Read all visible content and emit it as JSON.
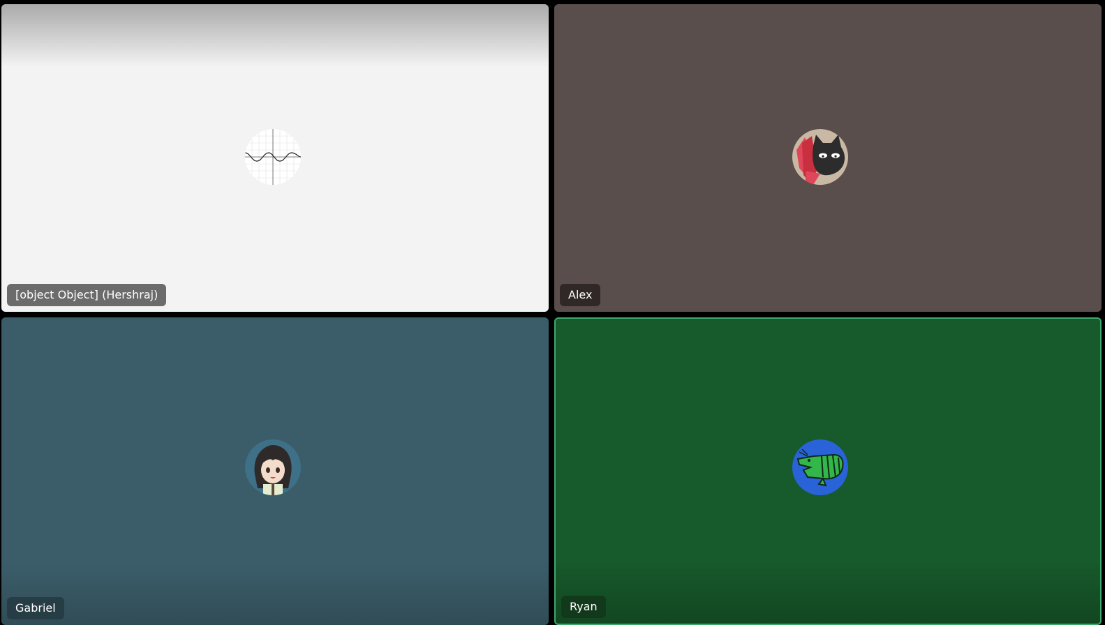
{
  "participants": [
    {
      "name": "[object Object] (Hershraj)",
      "tile_color": "#f3f3f3",
      "name_tag_color": "#6b6b6b",
      "avatar_icon": "sine-wave-graph-icon",
      "speaking": false
    },
    {
      "name": "Alex",
      "tile_color": "#5a4e4c",
      "name_tag_color": "#2f2826",
      "avatar_icon": "black-cat-red-scarf-icon",
      "speaking": false
    },
    {
      "name": "Gabriel",
      "tile_color": "#3b5d6a",
      "name_tag_color": "#263d46",
      "avatar_icon": "anime-girl-icon",
      "speaking": false
    },
    {
      "name": "Ryan",
      "tile_color": "#175a2b",
      "name_tag_color": "#13391d",
      "avatar_icon": "green-shrimp-icon",
      "speaking": true,
      "speaking_border_color": "#3fa86a"
    }
  ]
}
